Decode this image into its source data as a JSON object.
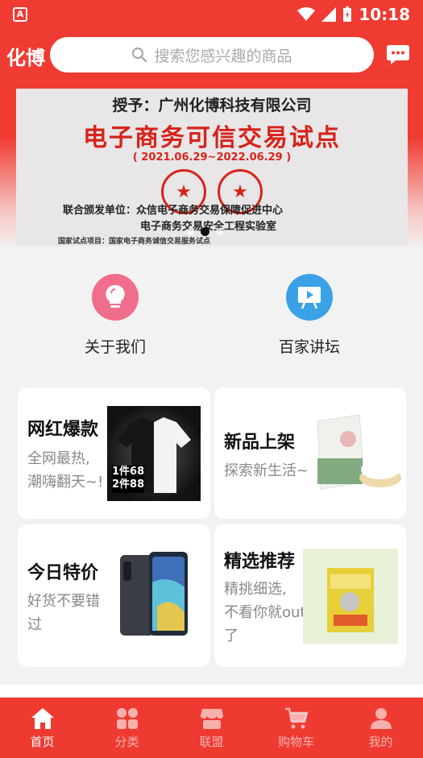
{
  "status_bar": {
    "time": "10:18"
  },
  "header": {
    "brand": "化博",
    "search_placeholder": "搜索您感兴趣的商品"
  },
  "banner": {
    "line1": "授予：广州化博科技有限公司",
    "line2": "电子商务可信交易试点",
    "line3": "( 2021.06.29~2022.06.29 )",
    "issuer_label": "联合颁发单位：众信电子商务交易保障促进中心",
    "issuer_2": "电子商务交易安全工程实验室",
    "note": "国家试点项目：国家电子商务诚信交易服务试点",
    "slide_count": 3,
    "active_slide": 2
  },
  "shortcuts": [
    {
      "label": "关于我们",
      "icon": "lightbulb-icon"
    },
    {
      "label": "百家讲坛",
      "icon": "presentation-icon"
    }
  ],
  "cards": [
    {
      "title": "网红爆款",
      "subtitle_1": "全网最热,",
      "subtitle_2": "潮嗨翻天~!",
      "image": "tshirt-image"
    },
    {
      "title": "新品上架",
      "subtitle_1": "探索新生活~",
      "image": "rice-bag-image"
    },
    {
      "title": "今日特价",
      "subtitle_1": "好货不要错",
      "subtitle_2": "过",
      "image": "phone-image"
    },
    {
      "title": "精选推荐",
      "subtitle_1": "精挑细选,",
      "subtitle_2": "不看你就out",
      "subtitle_3": "了",
      "image": "cat-litter-image"
    }
  ],
  "tshirt_price": {
    "line1": "1件68",
    "line2": "2件88"
  },
  "bottom_nav": [
    {
      "label": "首页",
      "icon": "home-icon",
      "active": true
    },
    {
      "label": "分类",
      "icon": "grid-icon",
      "active": false
    },
    {
      "label": "联盟",
      "icon": "store-icon",
      "active": false
    },
    {
      "label": "购物车",
      "icon": "cart-icon",
      "active": false
    },
    {
      "label": "我的",
      "icon": "user-icon",
      "active": false
    }
  ],
  "colors": {
    "primary": "#ee3a31",
    "banner_red": "#d7231b",
    "pink": "#f06d8c",
    "blue": "#3aa1e6"
  }
}
